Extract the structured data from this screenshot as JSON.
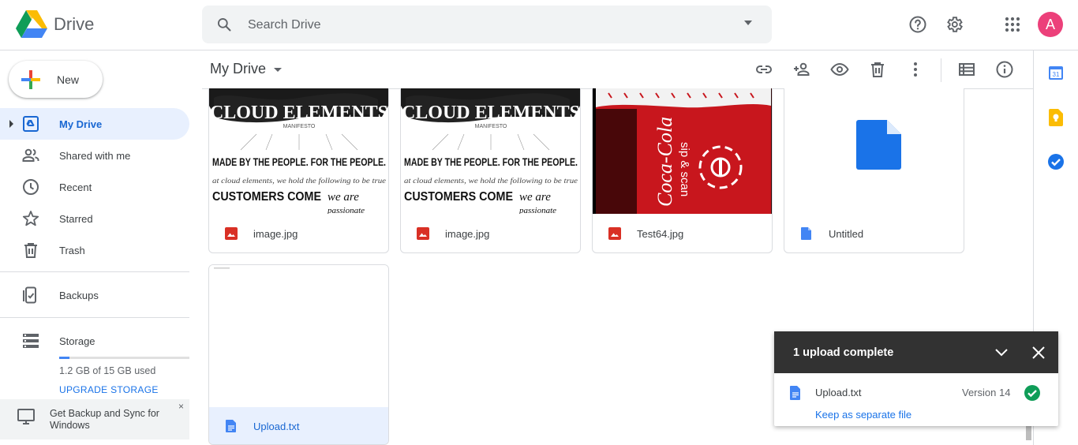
{
  "header": {
    "app_name": "Drive",
    "search_placeholder": "Search Drive",
    "avatar_letter": "A"
  },
  "sidebar": {
    "new_label": "New",
    "items": [
      {
        "label": "My Drive",
        "icon": "my-drive-icon",
        "active": true
      },
      {
        "label": "Shared with me",
        "icon": "shared-icon"
      },
      {
        "label": "Recent",
        "icon": "clock-icon"
      },
      {
        "label": "Starred",
        "icon": "star-icon"
      },
      {
        "label": "Trash",
        "icon": "trash-icon"
      },
      {
        "label": "Backups",
        "icon": "backup-icon"
      },
      {
        "label": "Storage",
        "icon": "storage-icon"
      }
    ],
    "storage": {
      "used_text": "1.2 GB of 15 GB used",
      "used_fraction": 0.08,
      "upgrade_label": "UPGRADE STORAGE"
    },
    "promo": {
      "text": "Get Backup and Sync for Windows",
      "close": "×"
    }
  },
  "main": {
    "title": "My Drive",
    "files": [
      {
        "name": "image.jpg",
        "type": "image",
        "thumb": "poster"
      },
      {
        "name": "image.jpg",
        "type": "image",
        "thumb": "poster"
      },
      {
        "name": "Test64.jpg",
        "type": "image",
        "thumb": "can"
      },
      {
        "name": "Untitled",
        "type": "doc",
        "thumb": "doc"
      },
      {
        "name": "Upload.txt",
        "type": "doc",
        "thumb": "blank",
        "selected": true
      }
    ],
    "poster_lines": {
      "title": "CLOUD ELEMENTS",
      "sub": "MANIFESTO",
      "line1": "MADE BY THE PEOPLE. FOR THE PEOPLE.",
      "line2": "at cloud elements, we hold the following to be true",
      "line3": "CUSTOMERS COME",
      "line4": "we are",
      "line5": "passionate"
    },
    "can_lines": {
      "brand": "Coca-Cola",
      "sip": "sip & scan"
    }
  },
  "toast": {
    "title": "1 upload complete",
    "file_name": "Upload.txt",
    "version": "Version 14",
    "action": "Keep as separate file"
  },
  "colors": {
    "accent": "#1a73e8",
    "active_bg": "#e8f0fe",
    "image_icon": "#d93025",
    "doc_icon": "#4285f4",
    "success": "#0f9d58",
    "avatar": "#ec407a"
  }
}
